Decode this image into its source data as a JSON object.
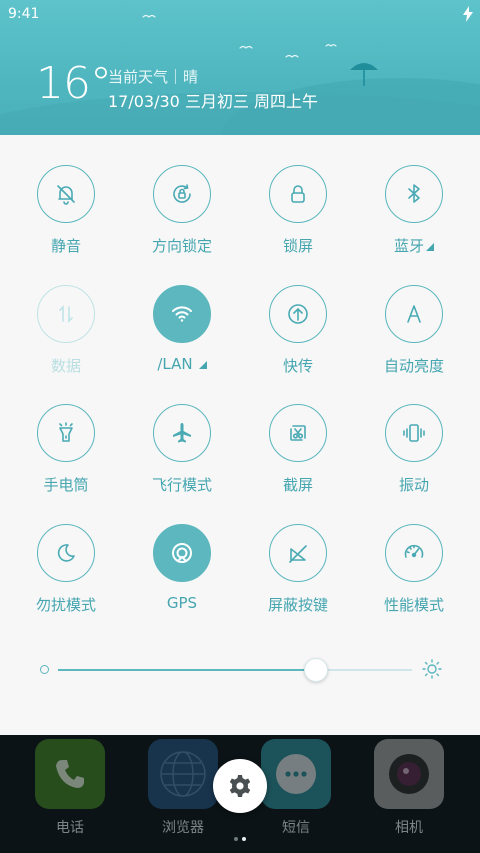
{
  "status": {
    "time": "9:41"
  },
  "weather": {
    "temperature": "16°",
    "description": "当前天气｜晴",
    "date": "17/03/30 三月初三 周四上午"
  },
  "toggles": [
    {
      "label": "静音",
      "icon": "bell-off-icon",
      "state": "off"
    },
    {
      "label": "方向锁定",
      "icon": "rotation-lock-icon",
      "state": "off"
    },
    {
      "label": "锁屏",
      "icon": "lock-icon",
      "state": "off"
    },
    {
      "label": "蓝牙",
      "icon": "bluetooth-icon",
      "state": "off",
      "has_menu": true
    },
    {
      "label": "数据",
      "icon": "mobile-data-icon",
      "state": "disabled"
    },
    {
      "label": "/LAN",
      "icon": "wifi-icon",
      "state": "on",
      "has_menu": true
    },
    {
      "label": "快传",
      "icon": "quick-transfer-icon",
      "state": "off"
    },
    {
      "label": "自动亮度",
      "icon": "auto-brightness-icon",
      "state": "off"
    },
    {
      "label": "手电筒",
      "icon": "flashlight-icon",
      "state": "off"
    },
    {
      "label": "飞行模式",
      "icon": "airplane-icon",
      "state": "off"
    },
    {
      "label": "截屏",
      "icon": "screenshot-icon",
      "state": "off"
    },
    {
      "label": "振动",
      "icon": "vibrate-icon",
      "state": "off"
    },
    {
      "label": "勿扰模式",
      "icon": "moon-icon",
      "state": "off"
    },
    {
      "label": "GPS",
      "icon": "gps-icon",
      "state": "on"
    },
    {
      "label": "屏蔽按键",
      "icon": "block-keys-icon",
      "state": "off"
    },
    {
      "label": "性能模式",
      "icon": "speedometer-icon",
      "state": "off"
    }
  ],
  "brightness": {
    "value": 0.73
  },
  "dock": {
    "apps": [
      {
        "label": "电话",
        "icon": "phone-icon",
        "color": "#4f9a2e"
      },
      {
        "label": "浏览器",
        "icon": "browser-globe-icon",
        "color": "#2a5d8e"
      },
      {
        "label": "短信",
        "icon": "messages-icon",
        "color": "#35a7b3"
      },
      {
        "label": "相机",
        "icon": "camera-icon",
        "color": "#c8c8c8"
      }
    ],
    "pager": {
      "pages": 2,
      "active": 2
    }
  },
  "colors": {
    "accent": "#5cb7bf",
    "header": "#4fb6bf",
    "panel": "#f7f7f7"
  }
}
